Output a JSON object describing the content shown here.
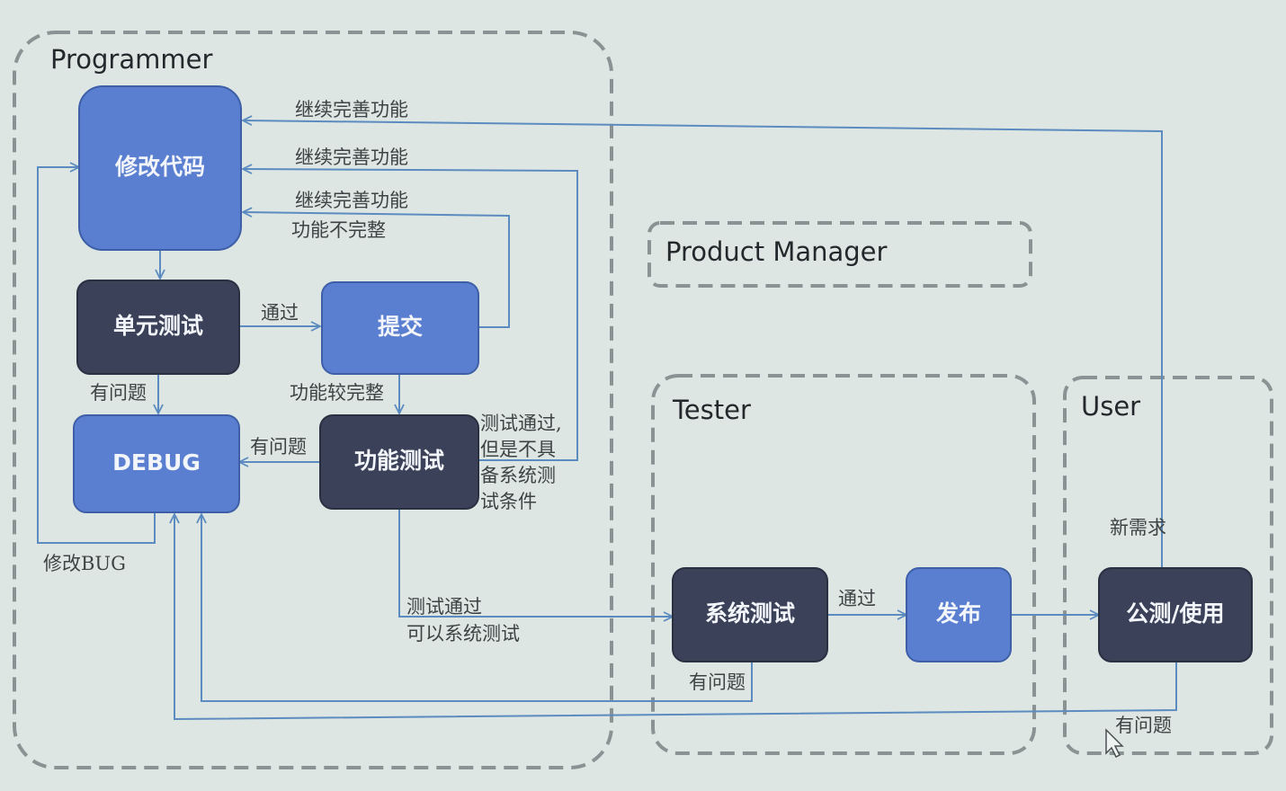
{
  "groups": {
    "programmer": "Programmer",
    "product_manager": "Product Manager",
    "tester": "Tester",
    "user": "User"
  },
  "nodes": {
    "modify_code": "修改代码",
    "unit_test": "单元测试",
    "submit": "提交",
    "debug": "DEBUG",
    "function_test": "功能测试",
    "system_test": "系统测试",
    "release": "发布",
    "public_test": "公测/使用"
  },
  "edges": {
    "continue_improve_1": "继续完善功能",
    "continue_improve_2": "继续完善功能",
    "continue_improve_3": "继续完善功能",
    "function_incomplete": "功能不完整",
    "pass_unit_to_submit": "通过",
    "has_problem_unit": "有问题",
    "function_more_complete": "功能较完整",
    "has_problem_function": "有问题",
    "test_pass_not_ready": [
      "测试通过,",
      "但是不具",
      "备系统测",
      "试条件"
    ],
    "modify_bug": "修改BUG",
    "test_pass_can_system": [
      "测试通过",
      "可以系统测试"
    ],
    "pass_system_to_release": "通过",
    "has_problem_system": "有问题",
    "new_requirement": "新需求",
    "has_problem_user": "有问题"
  },
  "colors": {
    "blue_box": "#5b7fd0",
    "dark_box": "#3b4158",
    "connector": "#5b8bbf"
  }
}
